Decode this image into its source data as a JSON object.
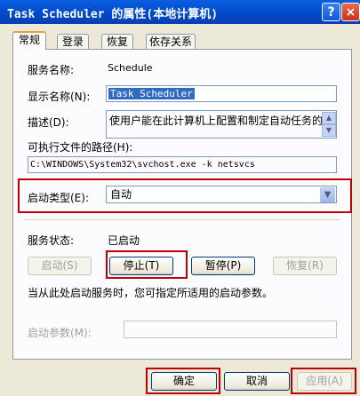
{
  "window": {
    "title": "Task Scheduler 的属性(本地计算机)",
    "help_glyph": "?",
    "close_glyph": "×"
  },
  "tabs": [
    {
      "label": "常规",
      "active": true
    },
    {
      "label": "登录"
    },
    {
      "label": "恢复"
    },
    {
      "label": "依存关系"
    }
  ],
  "general": {
    "service_name_label": "服务名称:",
    "service_name_value": "Schedule",
    "display_name_label": "显示名称(N):",
    "display_name_value": "Task Scheduler",
    "description_label": "描述(D):",
    "description_value": "使用户能在此计算机上配置和制定自动任务的",
    "exe_path_label": "可执行文件的路径(H):",
    "exe_path_value": "C:\\WINDOWS\\System32\\svchost.exe -k netsvcs",
    "startup_type_label": "启动类型(E):",
    "startup_type_value": "自动",
    "service_status_label": "服务状态:",
    "service_status_value": "已启动",
    "start_button": "启动(S)",
    "stop_button": "停止(T)",
    "pause_button": "暂停(P)",
    "resume_button": "恢复(R)",
    "hint_text": "当从此处启动服务时，您可指定所适用的启动参数。",
    "start_params_label": "启动参数(M):",
    "start_params_value": ""
  },
  "footer": {
    "ok_button": "确定",
    "cancel_button": "取消",
    "apply_button": "应用(A)"
  },
  "colors": {
    "highlight_box": "#c00000",
    "title_bar": "#0048c8"
  }
}
